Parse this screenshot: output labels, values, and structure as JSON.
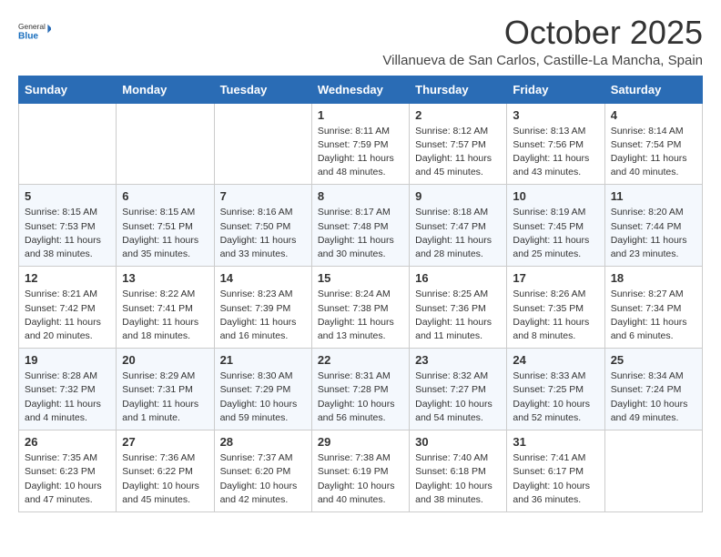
{
  "logo": {
    "general": "General",
    "blue": "Blue"
  },
  "header": {
    "month": "October 2025",
    "location": "Villanueva de San Carlos, Castille-La Mancha, Spain"
  },
  "weekdays": [
    "Sunday",
    "Monday",
    "Tuesday",
    "Wednesday",
    "Thursday",
    "Friday",
    "Saturday"
  ],
  "weeks": [
    [
      {
        "day": "",
        "content": ""
      },
      {
        "day": "",
        "content": ""
      },
      {
        "day": "",
        "content": ""
      },
      {
        "day": "1",
        "content": "Sunrise: 8:11 AM\nSunset: 7:59 PM\nDaylight: 11 hours and 48 minutes."
      },
      {
        "day": "2",
        "content": "Sunrise: 8:12 AM\nSunset: 7:57 PM\nDaylight: 11 hours and 45 minutes."
      },
      {
        "day": "3",
        "content": "Sunrise: 8:13 AM\nSunset: 7:56 PM\nDaylight: 11 hours and 43 minutes."
      },
      {
        "day": "4",
        "content": "Sunrise: 8:14 AM\nSunset: 7:54 PM\nDaylight: 11 hours and 40 minutes."
      }
    ],
    [
      {
        "day": "5",
        "content": "Sunrise: 8:15 AM\nSunset: 7:53 PM\nDaylight: 11 hours and 38 minutes."
      },
      {
        "day": "6",
        "content": "Sunrise: 8:15 AM\nSunset: 7:51 PM\nDaylight: 11 hours and 35 minutes."
      },
      {
        "day": "7",
        "content": "Sunrise: 8:16 AM\nSunset: 7:50 PM\nDaylight: 11 hours and 33 minutes."
      },
      {
        "day": "8",
        "content": "Sunrise: 8:17 AM\nSunset: 7:48 PM\nDaylight: 11 hours and 30 minutes."
      },
      {
        "day": "9",
        "content": "Sunrise: 8:18 AM\nSunset: 7:47 PM\nDaylight: 11 hours and 28 minutes."
      },
      {
        "day": "10",
        "content": "Sunrise: 8:19 AM\nSunset: 7:45 PM\nDaylight: 11 hours and 25 minutes."
      },
      {
        "day": "11",
        "content": "Sunrise: 8:20 AM\nSunset: 7:44 PM\nDaylight: 11 hours and 23 minutes."
      }
    ],
    [
      {
        "day": "12",
        "content": "Sunrise: 8:21 AM\nSunset: 7:42 PM\nDaylight: 11 hours and 20 minutes."
      },
      {
        "day": "13",
        "content": "Sunrise: 8:22 AM\nSunset: 7:41 PM\nDaylight: 11 hours and 18 minutes."
      },
      {
        "day": "14",
        "content": "Sunrise: 8:23 AM\nSunset: 7:39 PM\nDaylight: 11 hours and 16 minutes."
      },
      {
        "day": "15",
        "content": "Sunrise: 8:24 AM\nSunset: 7:38 PM\nDaylight: 11 hours and 13 minutes."
      },
      {
        "day": "16",
        "content": "Sunrise: 8:25 AM\nSunset: 7:36 PM\nDaylight: 11 hours and 11 minutes."
      },
      {
        "day": "17",
        "content": "Sunrise: 8:26 AM\nSunset: 7:35 PM\nDaylight: 11 hours and 8 minutes."
      },
      {
        "day": "18",
        "content": "Sunrise: 8:27 AM\nSunset: 7:34 PM\nDaylight: 11 hours and 6 minutes."
      }
    ],
    [
      {
        "day": "19",
        "content": "Sunrise: 8:28 AM\nSunset: 7:32 PM\nDaylight: 11 hours and 4 minutes."
      },
      {
        "day": "20",
        "content": "Sunrise: 8:29 AM\nSunset: 7:31 PM\nDaylight: 11 hours and 1 minute."
      },
      {
        "day": "21",
        "content": "Sunrise: 8:30 AM\nSunset: 7:29 PM\nDaylight: 10 hours and 59 minutes."
      },
      {
        "day": "22",
        "content": "Sunrise: 8:31 AM\nSunset: 7:28 PM\nDaylight: 10 hours and 56 minutes."
      },
      {
        "day": "23",
        "content": "Sunrise: 8:32 AM\nSunset: 7:27 PM\nDaylight: 10 hours and 54 minutes."
      },
      {
        "day": "24",
        "content": "Sunrise: 8:33 AM\nSunset: 7:25 PM\nDaylight: 10 hours and 52 minutes."
      },
      {
        "day": "25",
        "content": "Sunrise: 8:34 AM\nSunset: 7:24 PM\nDaylight: 10 hours and 49 minutes."
      }
    ],
    [
      {
        "day": "26",
        "content": "Sunrise: 7:35 AM\nSunset: 6:23 PM\nDaylight: 10 hours and 47 minutes."
      },
      {
        "day": "27",
        "content": "Sunrise: 7:36 AM\nSunset: 6:22 PM\nDaylight: 10 hours and 45 minutes."
      },
      {
        "day": "28",
        "content": "Sunrise: 7:37 AM\nSunset: 6:20 PM\nDaylight: 10 hours and 42 minutes."
      },
      {
        "day": "29",
        "content": "Sunrise: 7:38 AM\nSunset: 6:19 PM\nDaylight: 10 hours and 40 minutes."
      },
      {
        "day": "30",
        "content": "Sunrise: 7:40 AM\nSunset: 6:18 PM\nDaylight: 10 hours and 38 minutes."
      },
      {
        "day": "31",
        "content": "Sunrise: 7:41 AM\nSunset: 6:17 PM\nDaylight: 10 hours and 36 minutes."
      },
      {
        "day": "",
        "content": ""
      }
    ]
  ]
}
